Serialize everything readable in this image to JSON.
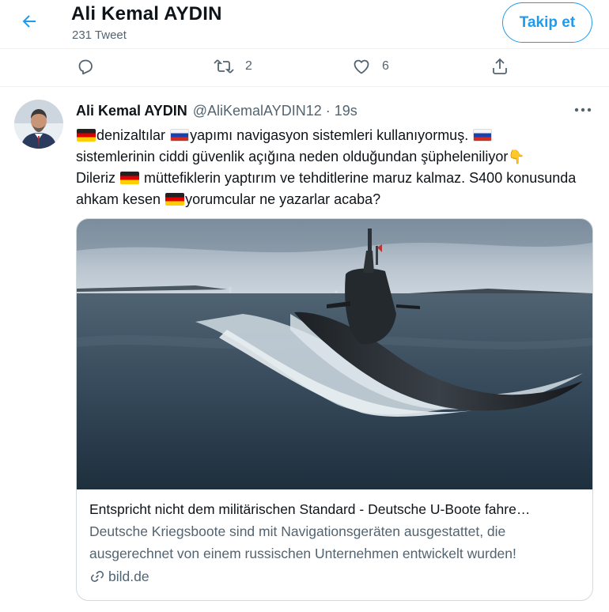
{
  "header": {
    "title": "Ali Kemal AYDIN",
    "subtitle": "231 Tweet",
    "follow_label": "Takip et"
  },
  "prev_tweet_actions": {
    "retweet_count": "2",
    "like_count": "6"
  },
  "tweet": {
    "author_name": "Ali Kemal AYDIN",
    "handle_time": "@AliKemalAYDIN12 · 19s",
    "segments": {
      "s1": "denizaltılar ",
      "s2": "yapımı navigasyon sistemleri kullanıyormuş. ",
      "s3": "sistemlerinin ciddi güvenlik açığına neden olduğundan şüpheleniliyor",
      "s4": "Dileriz ",
      "s5": " müttefiklerin yaptırım ve tehditlerine maruz kalmaz. S400 konusunda ahkam kesen ",
      "s6": "yorumcular ne yazarlar acaba?"
    }
  },
  "card": {
    "title": "Entspricht nicht dem militärischen Standard - Deutsche U-Boote fahre…",
    "description": "Deutsche Kriegsboote sind mit Navigationsgeräten ausgestattet, die ausgerechnet von einem russischen Unternehmen entwickelt wurden!",
    "domain": "bild.de"
  },
  "colors": {
    "accent": "#1d9bf0",
    "text": "#0f1419",
    "secondary": "#536471",
    "border": "#cfd9de"
  },
  "icons": [
    "back-arrow-icon",
    "reply-icon",
    "retweet-icon",
    "like-icon",
    "share-icon",
    "more-icon",
    "link-icon",
    "germany-flag-icon",
    "russia-flag-icon",
    "pointing-down-icon"
  ]
}
